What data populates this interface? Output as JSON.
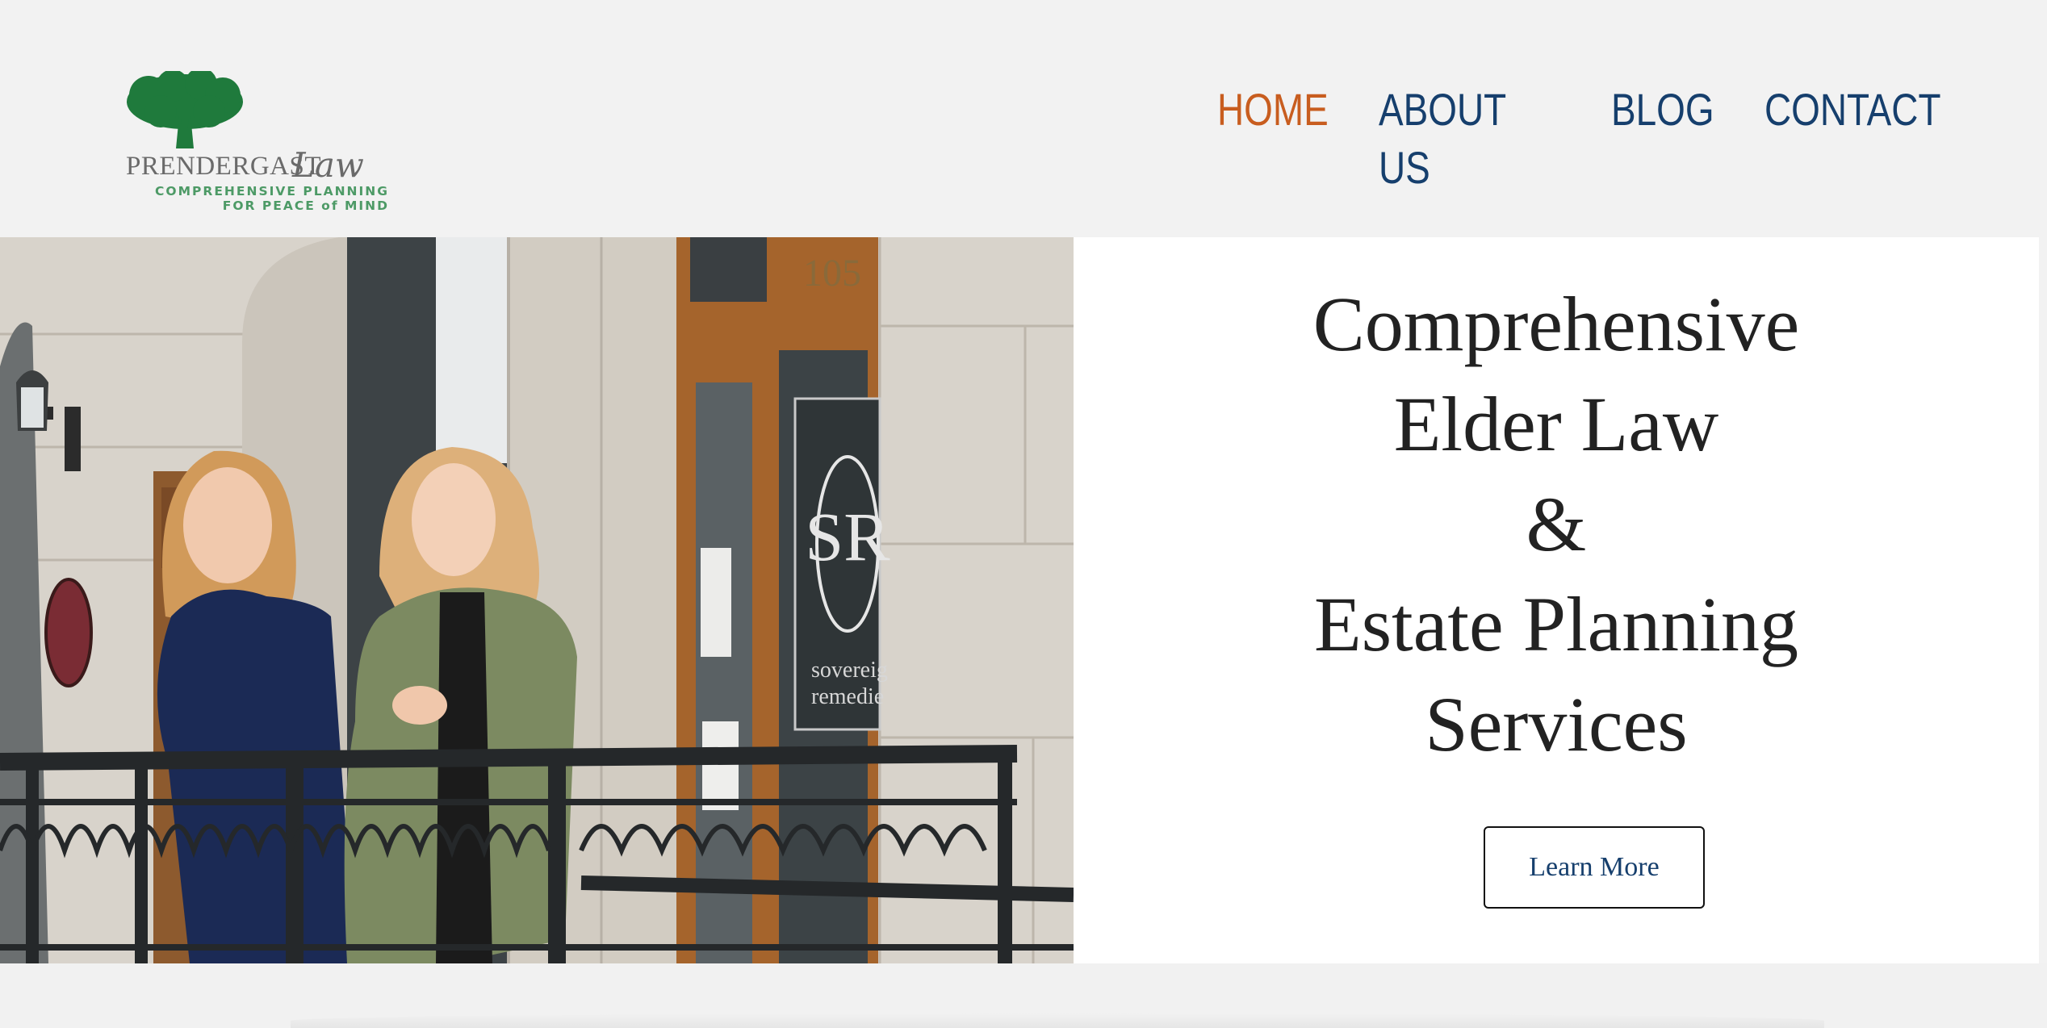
{
  "logo": {
    "name": "PRENDERGAST",
    "script": "Law",
    "tagline_1": "COMPREHENSIVE PLANNING",
    "tagline_2": "FOR PEACE of MIND"
  },
  "nav": {
    "items": [
      {
        "label": "HOME",
        "active": true
      },
      {
        "label": "ABOUT US",
        "active": false
      },
      {
        "label": "BLOG",
        "active": false
      },
      {
        "label": "CONTACT",
        "active": false
      }
    ]
  },
  "hero": {
    "headline_lines": [
      "Comprehensive",
      "Elder Law",
      "&",
      "Estate Planning",
      "Services"
    ],
    "button_label": "Learn More",
    "photo_address": "105",
    "door_sign_letters": "SR",
    "door_sign_text_1": "sovereig",
    "door_sign_text_2": "remedie"
  },
  "colors": {
    "nav_active": "#c85d1f",
    "nav_default": "#163f6d",
    "logo_green": "#1f7a3c",
    "headline": "#222222"
  }
}
